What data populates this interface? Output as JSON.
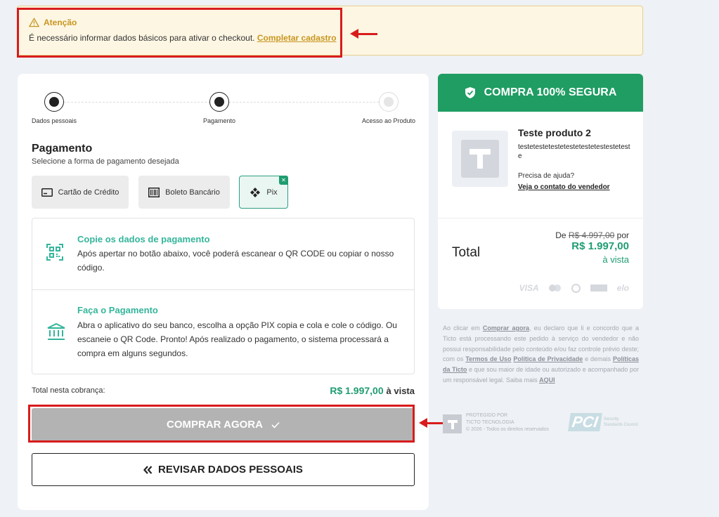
{
  "alert": {
    "title": "Atenção",
    "message": "É necessário informar dados básicos para ativar o checkout.",
    "link": "Completar cadastro"
  },
  "steps": [
    {
      "label": "Dados pessoais",
      "state": "done"
    },
    {
      "label": "Pagamento",
      "state": "current"
    },
    {
      "label": "Acesso ao Produto",
      "state": "pending"
    }
  ],
  "payment": {
    "title": "Pagamento",
    "subtitle": "Selecione a forma de pagamento desejada",
    "methods": [
      {
        "label": "Cartão de Crédito",
        "icon": "credit-card-icon",
        "selected": false
      },
      {
        "label": "Boleto Bancário",
        "icon": "barcode-icon",
        "selected": false
      },
      {
        "label": "Pix",
        "icon": "pix-icon",
        "selected": true
      }
    ]
  },
  "pix_info": [
    {
      "title": "Copie os dados de pagamento",
      "text": "Após apertar no botão abaixo, você poderá escanear o QR CODE ou copiar o nosso código.",
      "icon": "qr-code-icon"
    },
    {
      "title": "Faça o Pagamento",
      "text": "Abra o aplicativo do seu banco, escolha a opção PIX copia e cola e cole o código. Ou escaneie o QR Code. Pronto! Após realizado o pagamento, o sistema processará a compra em alguns segundos.",
      "icon": "bank-icon"
    }
  ],
  "total": {
    "label": "Total nesta cobrança:",
    "amount": "R$ 1.997,00",
    "suffix": "à vista"
  },
  "buttons": {
    "buy": "COMPRAR AGORA",
    "review": "REVISAR DADOS PESSOAIS"
  },
  "summary": {
    "secure_title": "COMPRA 100% SEGURA",
    "product_name": "Teste produto 2",
    "product_desc": "testetestetestetestetestetestesteteste",
    "help_text": "Precisa de ajuda?",
    "help_link": "Veja o contato do vendedor",
    "total_word": "Total",
    "price_prefix": "De",
    "price_old": "R$ 4.997,00",
    "price_mid": "por",
    "price_new": "R$ 1.997,00",
    "price_suffix": "à vista",
    "brands": [
      "VISA",
      "mastercard",
      "diners",
      "amex",
      "elo"
    ]
  },
  "legal": {
    "p1": "Ao clicar em",
    "buy_ref": "Comprar agora",
    "p2": ", eu declaro que li e concordo que a Ticto está processando este pedido à serviço do vendedor e não possui responsabilidade pelo conteúdo e/ou faz controle prévio deste; com os",
    "terms": "Termos de Uso",
    "privacy": "Política de Privacidade",
    "p3": "e demais",
    "policies": "Políticas da Ticto",
    "p4": "e que sou maior de idade ou autorizado e acompanhado por um responsável legal. Saiba mais",
    "more": "AQUI"
  },
  "footer": {
    "line1": "PROTEGIDO POR",
    "line2": "TICTO TECNOLOGIA",
    "line3": "© 2026 - Todos os direitos reservados",
    "pci_mark": "PCI",
    "pci_line1": "Security",
    "pci_line2": "Standards Council"
  },
  "colors": {
    "accent_green": "#1f9d63",
    "teal": "#34b59b",
    "warning": "#c8961f",
    "annotation_red": "#d81c1c"
  }
}
